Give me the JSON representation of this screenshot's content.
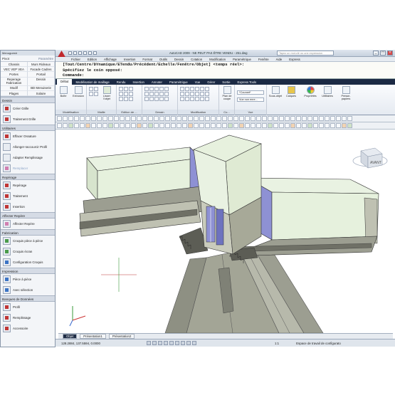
{
  "app": {
    "title": "AutoCAD 2009 - NE PEUT PAS ÊTRE VENDU - 251.dwg",
    "help_search_placeholder": "Tapez un mot-clé ou une expression",
    "window_buttons": [
      "_",
      "□",
      "×"
    ]
  },
  "menu": [
    "Fichier",
    "Edition",
    "Affichage",
    "Insertion",
    "Format",
    "Outils",
    "Dessin",
    "Cotation",
    "Modification",
    "Paramétrique",
    "Fenêtre",
    "Aide",
    "Express"
  ],
  "command_line": [
    "[Tout/Centre/DYnamique/ETendu/Précédent/Echelle/Fenêtre/Objet] <temps réel>:",
    "Spécifiez le coin opposé:",
    "Commande:"
  ],
  "ribbon_tabs": [
    "Début",
    "Modélisation de maillage",
    "Rendu",
    "Insertion",
    "Annoter",
    "Paramétrique",
    "Vue",
    "Gérer",
    "Sortie",
    "Express Tools"
  ],
  "ribbon": {
    "panels": [
      {
        "name": "Modélisation",
        "buttons": [
          "Boîte",
          "Extrusion"
        ]
      },
      {
        "name": "Maille",
        "buttons": [
          "Lisser l'objet"
        ]
      },
      {
        "name": "Edition de ...",
        "buttons": []
      },
      {
        "name": "Dessin",
        "buttons": []
      },
      {
        "name": "Modification",
        "buttons": []
      },
      {
        "name": "Co...",
        "buttons": [
          "Plan de coupe"
        ]
      },
      {
        "name": "Vue",
        "buttons": []
      },
      {
        "name": "",
        "buttons": [
          "Sous-objet",
          "Calques",
          "Propriétés",
          "Utilitaires",
          "Presse-papiers"
        ]
      }
    ],
    "layer_dropdown": "*Courant*",
    "view_dropdown": "Vue non enre..."
  },
  "left_panel": {
    "header": "Menuguestr",
    "search_left": "Pivot",
    "search_right": "Paramètre",
    "categories": [
      "Chassis",
      "Murs Rideaux",
      "VEC VEP VEA",
      "Facade Cadres",
      "Portes",
      "Portail",
      "Reperage Fabrication",
      "Dessin",
      "Modif",
      "BD Menuiserie",
      "Plages",
      "Solaire"
    ],
    "sections": [
      {
        "title": "Dessin",
        "tools": [
          "Créer Grille",
          "Traitement Grille"
        ]
      },
      {
        "title": "Utilitaires",
        "tools": [
          "Effacer Ossature",
          "Allonger-raccourcir Profil",
          "Adapter Remplissage",
          "Remplacer"
        ]
      },
      {
        "title": "Repérage",
        "tools": [
          "Repérage",
          "Traitement",
          "Insertion"
        ]
      },
      {
        "title": "Affecter Repère",
        "tools": [
          "Affecter Repère"
        ]
      },
      {
        "title": "Fabrication",
        "tools": [
          "Croquis pièce à pièce",
          "Croquis écran",
          "Configuration Croquis"
        ]
      },
      {
        "title": "Impression",
        "tools": [
          "Pièce à pièce",
          "Avec sélection"
        ]
      },
      {
        "title": "Banques de Données",
        "tools": [
          "Profil",
          "Remplissage",
          "Accessoire"
        ]
      }
    ]
  },
  "layout_tabs": [
    "Objet",
    "Présentation1",
    "Présentation2"
  ],
  "status": {
    "coords": "128.2884, 137.5594, 0.0000",
    "zoom_ratio": "1:1",
    "workspace": "Espace de travail de configurato"
  },
  "viewcube": {
    "label": "AVANT"
  },
  "colors": {
    "ribbon_tab_bar": "#1c2a44",
    "accent_red": "#c0282d",
    "profile_blue": "#8e91d4",
    "glass_green": "#e6f1dd",
    "aluminium_grey": "#a7a998"
  }
}
